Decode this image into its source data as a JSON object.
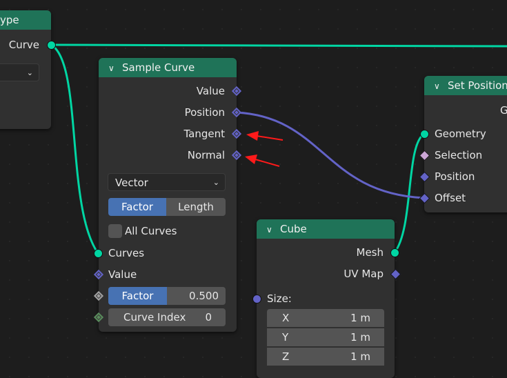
{
  "nodes": {
    "type_node": {
      "title_fragment": "ype",
      "output_curve": "Curve"
    },
    "sample_curve": {
      "title": "Sample Curve",
      "outputs": [
        "Value",
        "Position",
        "Tangent",
        "Normal"
      ],
      "data_type": "Vector",
      "mode_options": [
        "Factor",
        "Length"
      ],
      "mode_selected": "Factor",
      "all_curves_label": "All Curves",
      "all_curves_checked": false,
      "inputs": {
        "curves": "Curves",
        "value": "Value",
        "factor_label": "Factor",
        "factor_value": "0.500",
        "curve_index_label": "Curve Index",
        "curve_index_value": "0"
      }
    },
    "set_position": {
      "title_fragment": "Set Position",
      "output_fragment": "G",
      "inputs": [
        "Geometry",
        "Selection",
        "Position",
        "Offset"
      ]
    },
    "cube": {
      "title": "Cube",
      "outputs": [
        "Mesh",
        "UV Map"
      ],
      "size_label": "Size:",
      "size": [
        {
          "axis": "X",
          "value": "1 m"
        },
        {
          "axis": "Y",
          "value": "1 m"
        },
        {
          "axis": "Z",
          "value": "1 m"
        }
      ]
    }
  },
  "colors": {
    "header": "#1f7358",
    "geometry_wire": "#00d6a3",
    "vector_wire": "#6363c7",
    "annotation_arrow": "#ff1a1a",
    "selected_button": "#4772b3"
  },
  "icons": {
    "collapse": "chevron-down-icon",
    "dropdown": "chevron-down-icon"
  }
}
